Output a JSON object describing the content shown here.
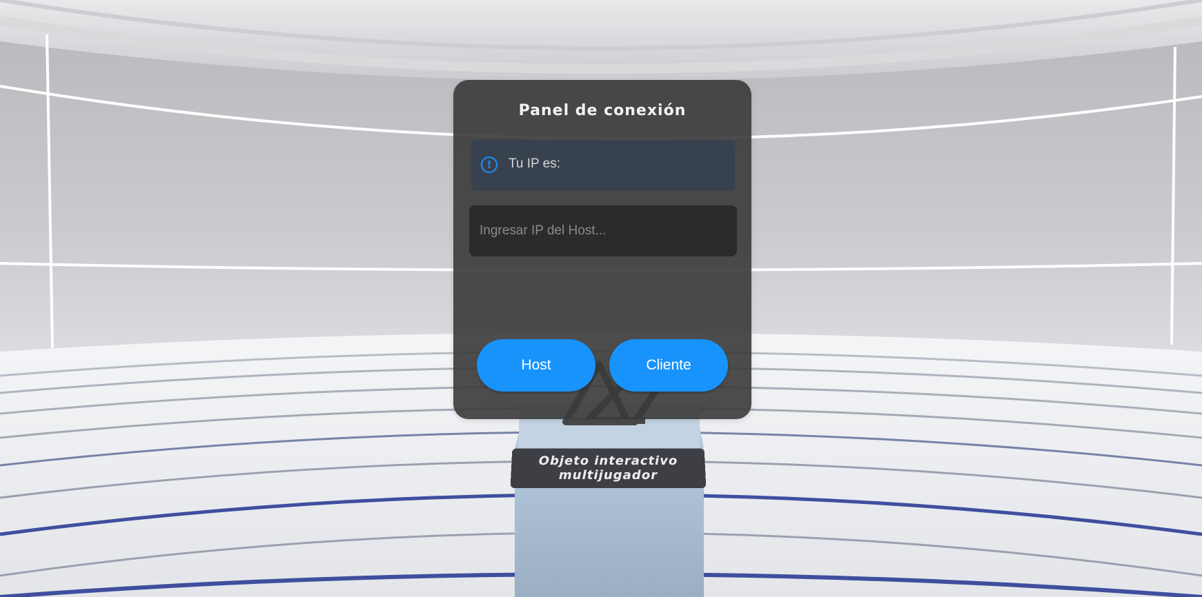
{
  "panel": {
    "title": "Panel de conexión",
    "info_icon": "exclamation-circle-icon",
    "info_text": "Tu IP es:",
    "ip_input": {
      "value": "",
      "placeholder": "Ingresar IP del Host..."
    },
    "host_button": "Host",
    "client_button": "Cliente"
  },
  "scene": {
    "object_label_line1": "Objeto interactivo",
    "object_label_line2": "multijugador",
    "object_icon": "geometric-logo-sculpture"
  },
  "colors": {
    "accent": "#1893fb",
    "panel_bg": "#3a3a3a",
    "ring_blue": "#3f4f9e"
  }
}
